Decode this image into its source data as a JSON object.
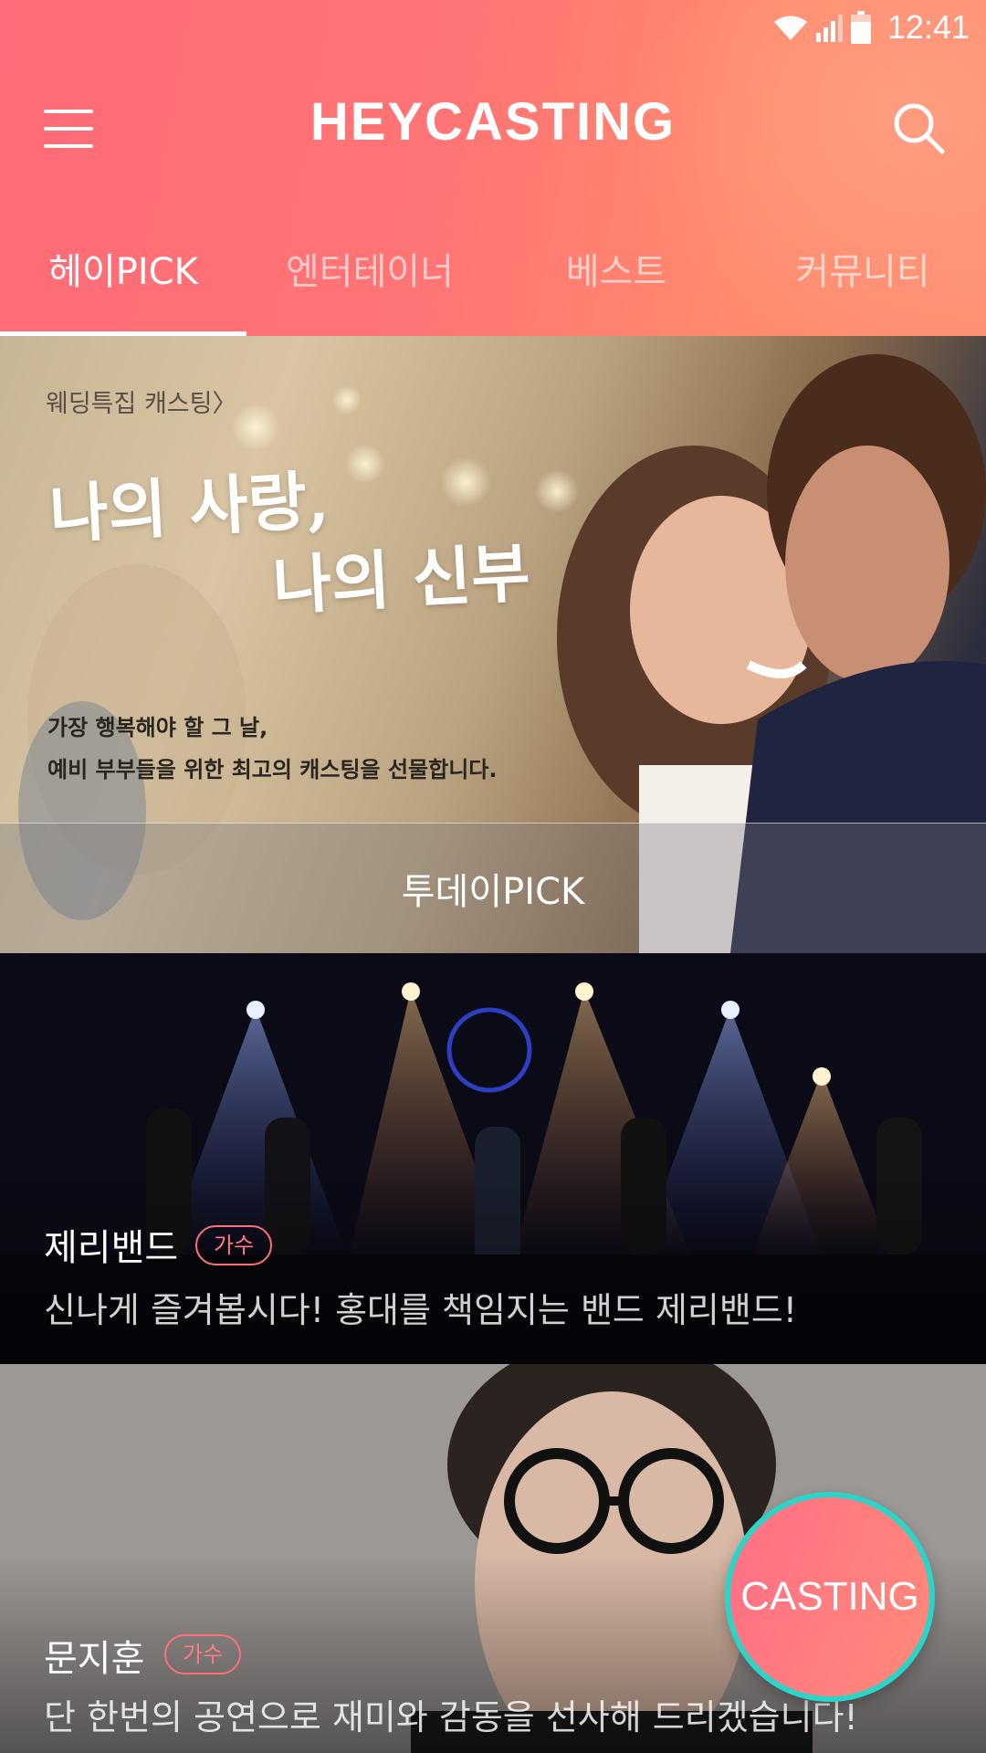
{
  "status_bar": {
    "time": "12:41"
  },
  "header": {
    "title": "HEYCASTING",
    "tabs": [
      {
        "label": "헤이PICK",
        "active": true
      },
      {
        "label": "엔터테이너",
        "active": false
      },
      {
        "label": "베스트",
        "active": false
      },
      {
        "label": "커뮤니티",
        "active": false
      }
    ]
  },
  "banner": {
    "category_link": "웨딩특집 캐스팅〉",
    "headline_line1": "나의 사랑,",
    "headline_line2": "나의 신부",
    "description_line1": "가장 행복해야 할 그 날,",
    "description_line2": "예비 부부들을 위한 최고의 캐스팅을 선물합니다.",
    "today_pick_label": "투데이PICK"
  },
  "cards": [
    {
      "name": "제리밴드",
      "tag": "가수",
      "description": "신나게 즐겨봅시다! 홍대를 책임지는 밴드 제리밴드!"
    },
    {
      "name": "문지훈",
      "tag": "가수",
      "description": "단 한번의 공연으로 재미와 감동을 선사해 드리겠습니다!"
    }
  ],
  "fab": {
    "label": "CASTING"
  },
  "colors": {
    "header_start": "#ff6b78",
    "header_end": "#ff8f73",
    "tag_accent": "#ff6f7a",
    "fab_ring": "#2ad4c9"
  },
  "icons": [
    "wifi-icon",
    "signal-icon",
    "battery-icon",
    "menu-icon",
    "search-icon"
  ]
}
